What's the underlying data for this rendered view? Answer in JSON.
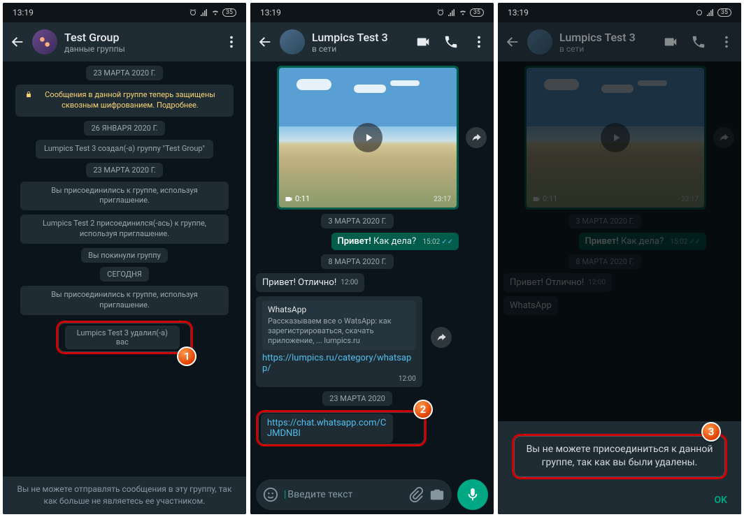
{
  "status": {
    "time": "13:19",
    "battery": "35"
  },
  "phone1": {
    "title": "Test Group",
    "subtitle": "данные группы",
    "date1": "23 МАРТА 2020 Г.",
    "encryption": "Сообщения в данной группе теперь защищены сквозным шифрованием. Подробнее.",
    "date2": "26 ЯНВАРЯ 2020 Г.",
    "sys1": "Lumpics Test 3 создал(-а) группу \"Test Group\"",
    "date3": "23 МАРТА 2020 Г.",
    "sys2": "Вы присоединились к группе, используя приглашение.",
    "sys3": "Lumpics Test 2 присоединился(-ась) к группе, используя приглашение.",
    "sys4": "Вы покинули группу",
    "date4": "СЕГОДНЯ",
    "sys5": "Вы присоединились к группе, используя приглашение.",
    "sys6": "Lumpics Test 3 удалил(-а) вас",
    "footer": "Вы не можете отправлять сообщения в эту группу, так как больше не являетесь ее участником."
  },
  "phone2": {
    "title": "Lumpics Test 3",
    "subtitle": "в сети",
    "video": {
      "duration": "0:11",
      "time": "23:17"
    },
    "date1": "3 МАРТА 2020 Г.",
    "out1_bold": "Привет!",
    "out1_rest": " Как дела?",
    "out1_time": "15:02",
    "date2": "8 МАРТА 2020 Г.",
    "in1": "Привет! Отлично!",
    "in1_time": "12:00",
    "card_title": "WhatsApp",
    "card_desc": "Рассказываем все о WatsApp: как зарегистрироваться, скачать приложение, ... lumpics.ru",
    "card_url": "https://lumpics.ru/category/whatsapp/",
    "card_time": "12:00",
    "date3": "23 МАРТА 2020",
    "invite_url": "https://chat.whatsapp.com/CJMDNBI",
    "input_placeholder": "Введите текст"
  },
  "phone3": {
    "title": "Lumpics Test 3",
    "subtitle": "в сети",
    "dialog_text": "Вы не можете присоединиться к данной группе, так как вы были удалены.",
    "dialog_ok": "OK"
  },
  "badges": {
    "b1": "1",
    "b2": "2",
    "b3": "3"
  }
}
